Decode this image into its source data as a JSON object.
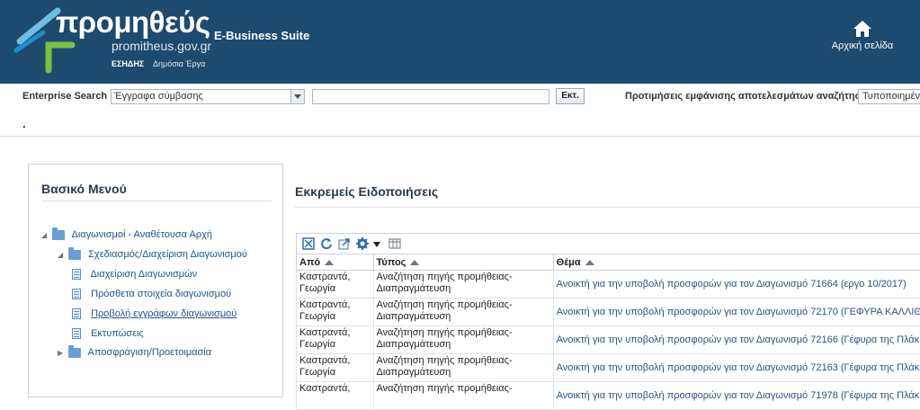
{
  "header": {
    "logo_title": "προμηθεύς",
    "logo_domain": "promitheus.gov.gr",
    "logo_org_bold": "ΕΣΗΔΗΣ",
    "logo_org_sub": "Δημόσια Έργα",
    "suite_title": "E-Business Suite",
    "home_label": "Αρχική σελίδα",
    "background_color": "#1e4a6e"
  },
  "search": {
    "label": "Enterprise Search",
    "category_value": "Έγγραφα σύμβασης",
    "query_value": "",
    "go_label": "Εκτ.",
    "pref_label": "Προτιμήσεις εμφάνισης αποτελεσμάτων αναζήτησης",
    "pref_value": "Τυποποιημέν"
  },
  "page_marker": ".",
  "menu": {
    "title": "Βασικό Μενού",
    "items": [
      {
        "label": "Διαγωνισμοί - Αναθέτουσα Αρχή",
        "expanded": true,
        "icon": "folder-icon"
      },
      {
        "label": "Σχεδιασμός/Διαχείριση Διαγωνισμού",
        "expanded": true,
        "icon": "folder-icon"
      },
      {
        "label": "Διαχείριση Διαγωνισμών",
        "icon": "page-icon"
      },
      {
        "label": "Πρόσθετα στοιχεία διαγωνισμού",
        "icon": "page-icon"
      },
      {
        "label": "Προβολή εγγράφων διαγωνισμού",
        "icon": "page-icon"
      },
      {
        "label": "Εκτυπώσεις",
        "icon": "page-icon"
      },
      {
        "label": "Αποσφράγιση/Προετοιμασία",
        "expanded": false,
        "icon": "folder-icon"
      }
    ]
  },
  "notifications": {
    "title": "Εκκρεμείς Ειδοποιήσεις",
    "columns": [
      "Από",
      "Τύπος",
      "Θέμα"
    ],
    "rows": [
      {
        "from_line1": "Καστραντά,",
        "from_line2": "Γεωργία",
        "type_line1": "Αναζήτηση πηγής προμήθειας-",
        "type_line2": "Διαπραγμάτευση",
        "subject": "Ανοικτή για την υποβολή προσφορών για τον Διαγωνισμό 71664 (εργο 10/2017)"
      },
      {
        "from_line1": "Καστραντά,",
        "from_line2": "Γεωργία",
        "type_line1": "Αναζήτηση πηγής προμήθειας-",
        "type_line2": "Διαπραγμάτευση",
        "subject": "Ανοικτή για την υποβολή προσφορών για τον Διαγωνισμό 72170 (ΓΕΦΥΡΑ ΚΑΛΛΙΘ"
      },
      {
        "from_line1": "Καστραντά,",
        "from_line2": "Γεωργία",
        "type_line1": "Αναζήτηση πηγής προμήθειας-",
        "type_line2": "Διαπραγμάτευση",
        "subject": "Ανοικτή για την υποβολή προσφορών για τον Διαγωνισμό 72166 (Γέφυρα της Πλάκ"
      },
      {
        "from_line1": "Καστραντά,",
        "from_line2": "Γεωργία",
        "type_line1": "Αναζήτηση πηγής προμήθειας-",
        "type_line2": "Διαπραγμάτευση",
        "subject": "Ανοικτή για την υποβολή προσφορών για τον Διαγωνισμό 72163 (Γέφυρα της Πλάκ"
      },
      {
        "from_line1": "Καστραντά,",
        "from_line2": "",
        "type_line1": "Αναζήτηση πηγής προμήθειας-",
        "type_line2": "",
        "subject": "Ανοικτή για την υποβολή προσφορών για τον Διαγωνισμό 71978 (Γέφυρα της Πλάκ"
      }
    ]
  }
}
